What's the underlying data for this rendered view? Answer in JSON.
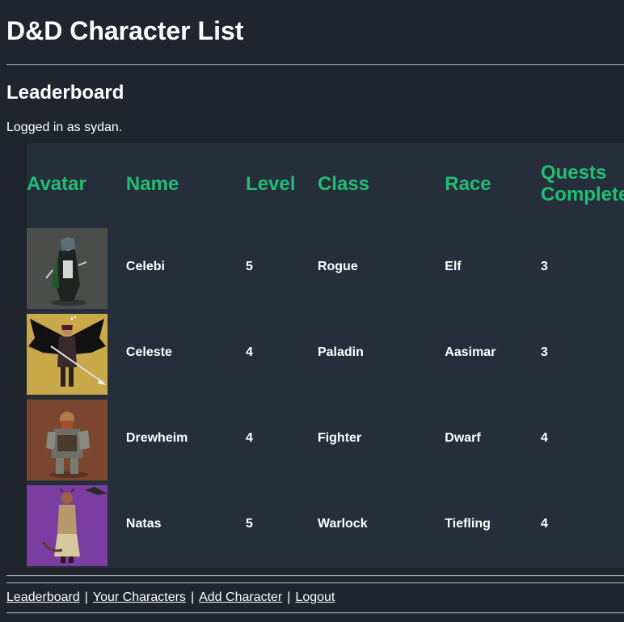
{
  "header": {
    "title": "D&D Character List",
    "section_title": "Leaderboard",
    "logged_in_text": "Logged in as sydan."
  },
  "table": {
    "columns": [
      "Avatar",
      "Name",
      "Level",
      "Class",
      "Race",
      "Quests Completed"
    ],
    "rows": [
      {
        "avatar": "hooded-elf-rogue-portrait",
        "name": "Celebi",
        "level": "5",
        "class": "Rogue",
        "race": "Elf",
        "quests": "3",
        "bg": "#4a4d4a"
      },
      {
        "avatar": "winged-aasimar-paladin-portrait",
        "name": "Celeste",
        "level": "4",
        "class": "Paladin",
        "race": "Aasimar",
        "quests": "3",
        "bg": "#c9a94a"
      },
      {
        "avatar": "armored-dwarf-fighter-portrait",
        "name": "Drewheim",
        "level": "4",
        "class": "Fighter",
        "race": "Dwarf",
        "quests": "4",
        "bg": "#7a4630"
      },
      {
        "avatar": "horned-tiefling-warlock-portrait",
        "name": "Natas",
        "level": "5",
        "class": "Warlock",
        "race": "Tiefling",
        "quests": "4",
        "bg": "#7b3ea0"
      }
    ]
  },
  "nav": {
    "items": [
      "Leaderboard",
      "Your Characters",
      "Add Character",
      "Logout"
    ],
    "separator": "|"
  },
  "colors": {
    "page_bg": "#1f242d",
    "table_bg": "#252e3a",
    "header_accent": "#1fbf73"
  }
}
